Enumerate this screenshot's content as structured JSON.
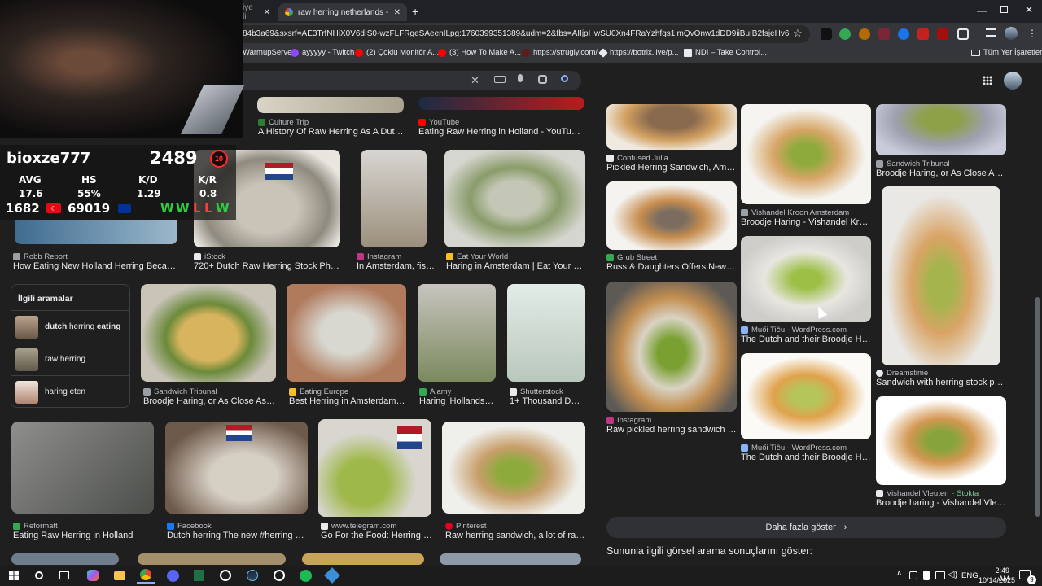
{
  "browser": {
    "tab_prev_label": "iye li",
    "tab_active_label": "raw herring netherlands - Goog",
    "address_url": "84b3a69&sxsrf=AE3TrfNHiX0V6dIS0-wzFLFRgeSAeenILpg:1760399351389&udm=2&fbs=AIIjpHwSU0Xn4FRaYzhfgs1jmQvOnw1dDD9iiBuIB2fsjeHv6Rzi_t8nCYrA3V...",
    "bookmarks": [
      "WarmupServer",
      "ayyyyy - Twitch",
      "(2) Çoklu Monitör A...",
      "(3) How To Make A...",
      "https://strugly.com/",
      "https://botrix.live/p...",
      "NDI – Take Control...",
      "Tüm Yer İşaretleri"
    ],
    "colors": {
      "chrome_bg": "#202124",
      "tab_active": "#35363a",
      "accent": "#8ab4f8"
    }
  },
  "hud": {
    "username": "bioxze777",
    "rating": "2489",
    "level": "10",
    "stat_headers": [
      "AVG",
      "HS",
      "K/D",
      "K/R"
    ],
    "stat_values": [
      "17.6",
      "55%",
      "1.29",
      "0.8"
    ],
    "elo_left": "1682",
    "elo_right": "69019",
    "streak": [
      "W",
      "W",
      "L",
      "L",
      "W"
    ],
    "flag": "NL"
  },
  "related": {
    "heading": "İlgili aramalar",
    "items": [
      {
        "bold": "dutch",
        "mid": " herring ",
        "bold2": "eating"
      },
      {
        "bold": "",
        "mid": "raw herring",
        "bold2": ""
      },
      {
        "bold": "",
        "mid": "haring eten",
        "bold2": ""
      }
    ]
  },
  "left_results": [
    {
      "source": "Culture Trip",
      "title": "A History Of Raw Herring As A Dutch D..."
    },
    {
      "source": "YouTube",
      "title": "Eating Raw Herring in Holland - YouTube"
    },
    {
      "source": "Robb Report",
      "title": "How Eating New Holland Herring Became a ..."
    },
    {
      "source": "iStock",
      "title": "720+ Dutch Raw Herring Stock Photos, ..."
    },
    {
      "source": "Instagram",
      "title": "In Amsterdam, fish..."
    },
    {
      "source": "Eat Your World",
      "title": "Haring in Amsterdam | Eat Your World"
    },
    {
      "source": "Sandwich Tribunal",
      "title": "Broodje Haring, or As Close As I C..."
    },
    {
      "source": "Eating Europe",
      "title": "Best Herring in Amsterdam | E..."
    },
    {
      "source": "Alamy",
      "title": "Haring 'Hollandse ..."
    },
    {
      "source": "Shutterstock",
      "title": "1+ Thousand Dutc..."
    },
    {
      "source": "Reformatt",
      "title": "Eating Raw Herring in Holland"
    },
    {
      "source": "Facebook",
      "title": "Dutch herring The new #herring seas..."
    },
    {
      "source": "www.telegram.com",
      "title": "Go For the Food: Herring sta..."
    },
    {
      "source": "Pinterest",
      "title": "Raw herring sandwich, a lot of raw h..."
    }
  ],
  "right_panel": {
    "col1": [
      {
        "source": "Confused Julia",
        "title": "Pickled Herring Sandwich, Amsterd..."
      },
      {
        "source": "Grub Street",
        "title": "Russ & Daughters Offers New-Cat..."
      },
      {
        "source": "Instagram",
        "title": "Raw pickled herring sandwich any..."
      }
    ],
    "col2": [
      {
        "source": "Vishandel Kroon Amsterdam",
        "title": "Broodje Haring - Vishandel Kroon ..."
      },
      {
        "source": "Muối Tiêu - WordPress.com",
        "title": "The Dutch and their Broodje Harin..."
      },
      {
        "source": "Muối Tiêu - WordPress.com",
        "title": "The Dutch and their Broodje Harin..."
      }
    ],
    "col3": [
      {
        "source": "Sandwich Tribunal",
        "title": "Broodje Haring, or As Close As I C..."
      },
      {
        "source": "Dreamstime",
        "title": "Sandwich with herring stock photo..."
      },
      {
        "source": "Vishandel Vleuten",
        "source_extra": "· Stokta",
        "title": "Broodje haring - Vishandel Vleuten"
      }
    ],
    "more_button": "Daha fazla göster",
    "footer_text": "Sununla ilgili görsel arama sonuçlarını göster:"
  },
  "taskbar": {
    "language": "ENG",
    "time": "2:49 AM",
    "date": "10/14/2025",
    "notif_count": "9"
  },
  "icons": [
    "search-icon",
    "close-icon",
    "mic-icon",
    "keyboard-icon",
    "lens-icon",
    "apps-grid-icon",
    "star-icon",
    "chevron-right-icon",
    "windows-start-icon"
  ]
}
